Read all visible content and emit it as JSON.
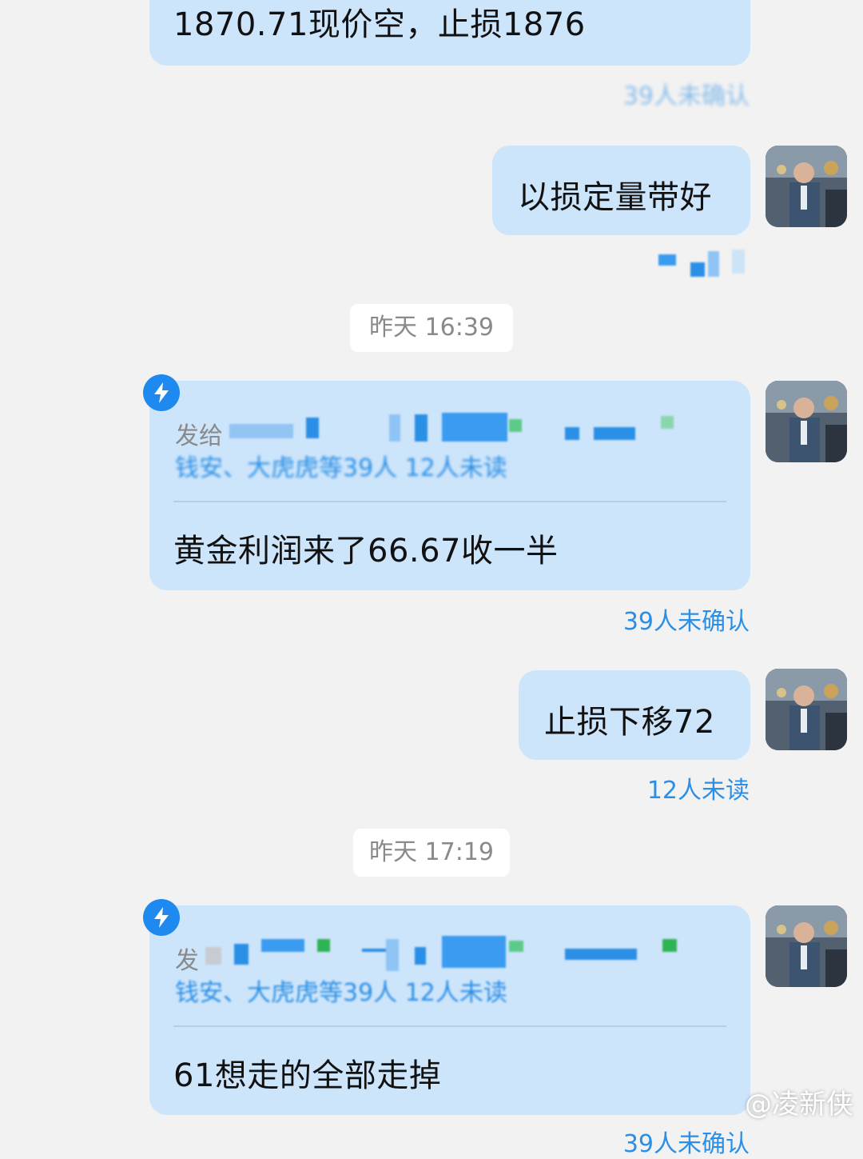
{
  "messages": {
    "m1": {
      "text": "1870.71现价空，止损1876",
      "status": "39人未确认"
    },
    "m2": {
      "text": "以损定量带好"
    },
    "t1": {
      "time": "昨天 16:39"
    },
    "m3": {
      "to_label": "发给",
      "recipients_line2": "钱安、大虎虎等39人 12人未读",
      "text": "黄金利润来了66.67收一半",
      "status": "39人未确认"
    },
    "m4": {
      "text": "止损下移72",
      "status": "12人未读"
    },
    "t2": {
      "time": "昨天 17:19"
    },
    "m5": {
      "to_label": "发",
      "recipients_line2": "钱安、大虎虎等39人 12人未读",
      "text": "61想走的全部走掉",
      "status": "39人未确认"
    }
  },
  "watermark": "@凌新侠",
  "colors": {
    "bubble": "#cde5fb",
    "accent": "#2b8fe6",
    "bolt": "#1e8af0",
    "background": "#f2f2f2"
  },
  "icons": {
    "ding": "lightning-bolt-icon",
    "avatar": "user-avatar-photo"
  }
}
